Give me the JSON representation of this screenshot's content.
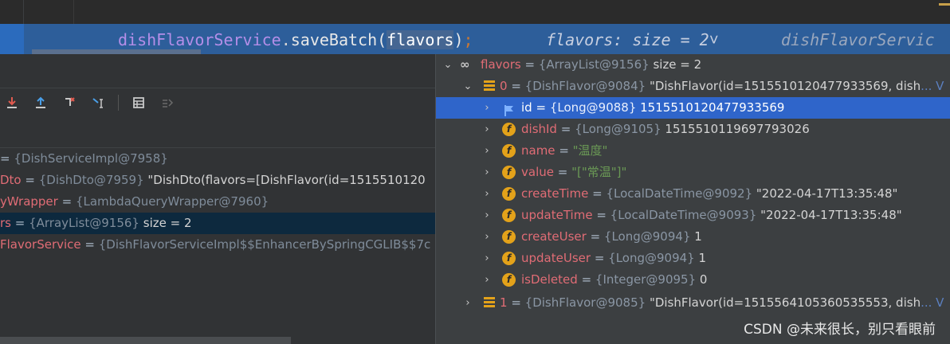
{
  "editor": {
    "code": {
      "receiver": "dishFlavorService",
      "dot": ".",
      "method": "saveBatch",
      "open_paren": "(",
      "arg": "flavors",
      "close_paren": ")",
      "semicolon": ";"
    },
    "inline_hint": "flavors:  size = 2˅",
    "inline_hint_tail": "dishFlavorServic"
  },
  "toolbar": {
    "icons": [
      "step-over-red-icon",
      "step-out-icon",
      "drop-frame-icon",
      "run-to-cursor-icon",
      "evaluate-icon",
      "trace-icon"
    ]
  },
  "variables": [
    {
      "name": "",
      "eq": "= ",
      "type": "{DishServiceImpl@7958}",
      "value": ""
    },
    {
      "name": "Dto",
      "eq": " = ",
      "type": "{DishDto@7959}",
      "value": " \"DishDto(flavors=[DishFlavor(id=1515510120"
    },
    {
      "name": "yWrapper",
      "eq": " = ",
      "type": "{LambdaQueryWrapper@7960}",
      "value": ""
    },
    {
      "name": "rs",
      "eq": " = ",
      "type": "{ArrayList@9156}",
      "value": "  size = 2"
    },
    {
      "name": "FlavorService",
      "eq": " = ",
      "type": "{DishFlavorServiceImpl$$EnhancerBySpringCGLIB$$7c",
      "value": ""
    }
  ],
  "tree": {
    "root": {
      "name": "flavors",
      "eq": " = ",
      "type": "{ArrayList@9156}",
      "value": "  size = 2"
    },
    "item0": {
      "name": "0",
      "eq": " = ",
      "type": "{DishFlavor@9084}",
      "value": " \"DishFlavor(id=1515510120477933569, dish",
      "ellipsis": "... V"
    },
    "fields": [
      {
        "name": "id",
        "type": "{Long@9088}",
        "value": " 1515510120477933569",
        "str": false
      },
      {
        "name": "dishId",
        "type": "{Long@9105}",
        "value": " 1515510119697793026",
        "str": false
      },
      {
        "name": "name",
        "type": "",
        "value": "\"温度\"",
        "str": true
      },
      {
        "name": "value",
        "type": "",
        "value": "\"[\"常温\"]\"",
        "str": true
      },
      {
        "name": "createTime",
        "type": "{LocalDateTime@9092}",
        "value": " \"2022-04-17T13:35:48\"",
        "str": false
      },
      {
        "name": "updateTime",
        "type": "{LocalDateTime@9093}",
        "value": " \"2022-04-17T13:35:48\"",
        "str": false
      },
      {
        "name": "createUser",
        "type": "{Long@9094}",
        "value": " 1",
        "str": false
      },
      {
        "name": "updateUser",
        "type": "{Long@9094}",
        "value": " 1",
        "str": false
      },
      {
        "name": "isDeleted",
        "type": "{Integer@9095}",
        "value": " 0",
        "str": false
      }
    ],
    "item1": {
      "name": "1",
      "eq": " = ",
      "type": "{DishFlavor@9085}",
      "value": " \"DishFlavor(id=1515564105360535553, dish",
      "ellipsis": "... V"
    }
  },
  "watermark": "CSDN @未来很长，别只看眼前",
  "colors": {
    "selection": "#2f65ca",
    "exec_line": "#2d5e9a",
    "field_icon": "#e3a21a",
    "var_name": "#e06c75"
  }
}
